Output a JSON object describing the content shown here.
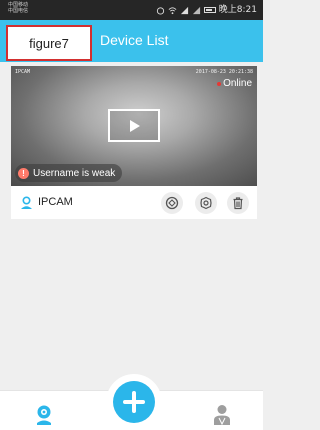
{
  "status_bar": {
    "carrier_line1": "中国移动",
    "carrier_line2": "中国电信",
    "time": "晚上8:21"
  },
  "header": {
    "title": "Device List",
    "figure_label": "figure7"
  },
  "device": {
    "overlay_name": "IPCAM",
    "timestamp": "2017-08-23 20:21:38",
    "status": "Online",
    "warning": "Username is weak",
    "name": "IPCAM"
  },
  "icons": {
    "user": "user-icon",
    "playback": "playback-icon",
    "settings": "gear-icon",
    "delete": "trash-icon",
    "camera_tab": "camera-icon",
    "add": "plus-icon",
    "profile_tab": "person-icon"
  },
  "colors": {
    "accent": "#3bc1ec",
    "fab": "#2bb6ea",
    "highlight_border": "#d32f2f",
    "online_dot": "#e53935",
    "warning_icon": "#ff7b6b"
  }
}
